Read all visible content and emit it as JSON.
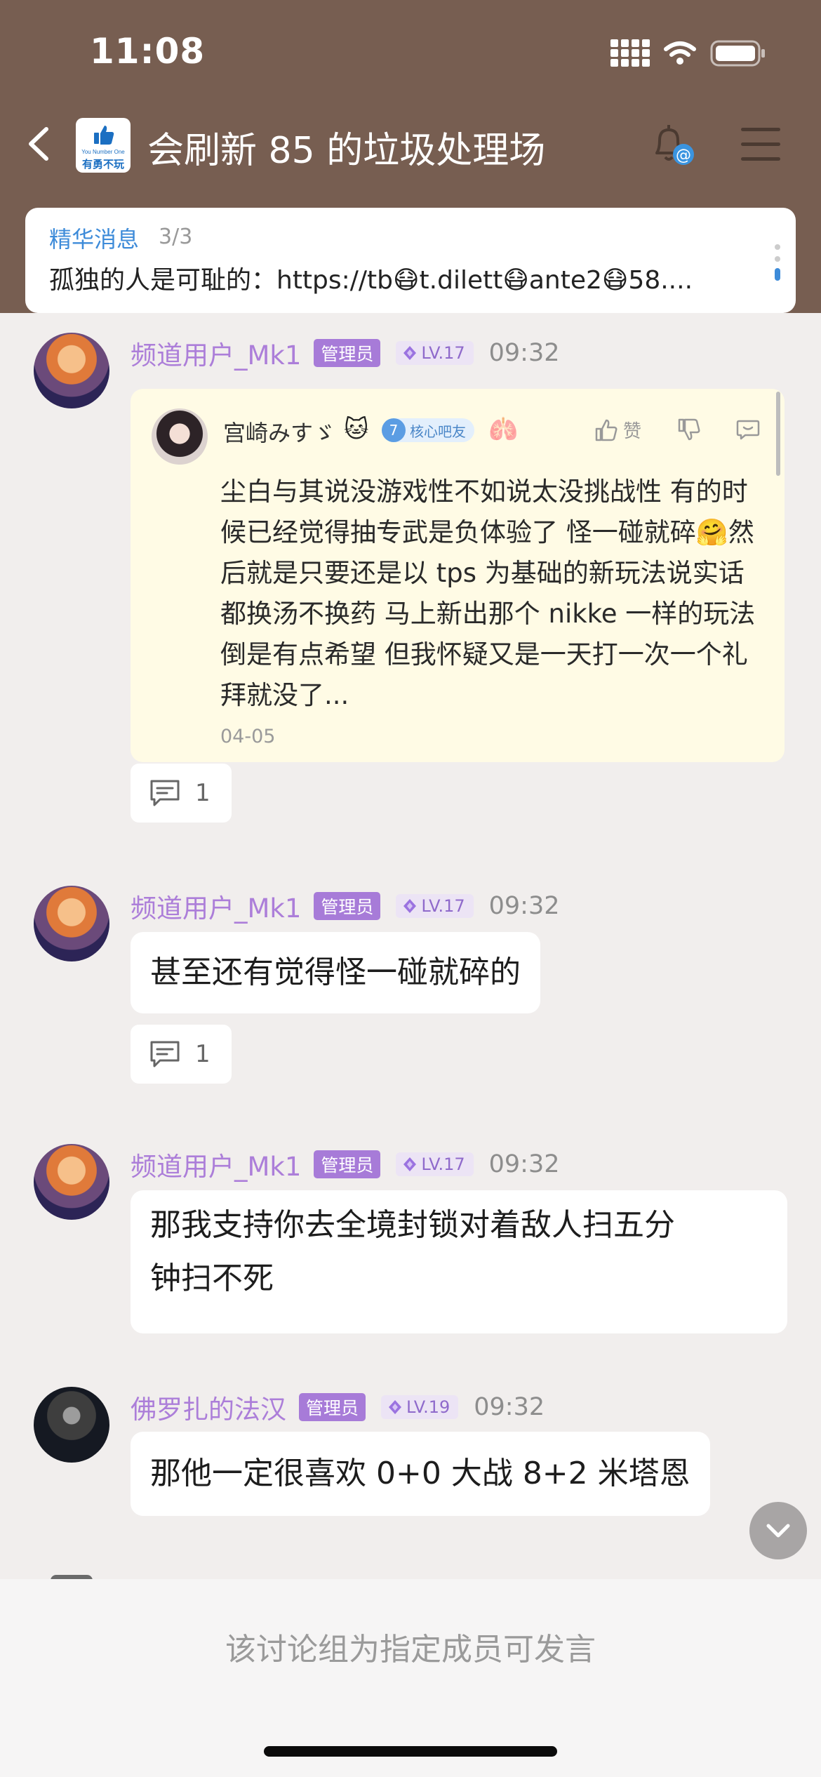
{
  "status_bar": {
    "time": "11:08"
  },
  "nav": {
    "title": "会刷新 85 的垃圾处理场",
    "logo": {
      "text_en": "You Number One",
      "text_cn": "有勇不玩"
    }
  },
  "essence": {
    "label": "精华消息",
    "count": "3/3",
    "text": "孤独的人是可耻的：https://tb😷t.dilett😷ante2😷58...."
  },
  "messages": [
    {
      "user": "频道用户_Mk1",
      "role": "管理员",
      "level": "LV.17",
      "time": "09:32",
      "quote": {
        "user": "宫崎みすゞ",
        "user_emoji": "🐱",
        "badge_num": "7",
        "badge_text": "核心吧友",
        "emoji2": "🫁",
        "like_label": "赞",
        "text": "尘白与其说没游戏性不如说太没挑战性 有的时候已经觉得抽专武是负体验了 怪一碰就碎🤗然后就是只要还是以 tps 为基础的新玩法说实话都换汤不换药 马上新出那个 nikke 一样的玩法倒是有点希望 但我怀疑又是一天打一次一个礼拜就没了...",
        "date": "04-05"
      },
      "replies": "1"
    },
    {
      "user": "频道用户_Mk1",
      "role": "管理员",
      "level": "LV.17",
      "time": "09:32",
      "text": "甚至还有觉得怪一碰就碎的",
      "replies": "1"
    },
    {
      "user": "频道用户_Mk1",
      "role": "管理员",
      "level": "LV.17",
      "time": "09:32",
      "text_line1": "那我支持你去全境封锁对着敌人扫五分",
      "text_line2": "钟扫不死"
    },
    {
      "user": "佛罗扎的法汉",
      "role": "管理员",
      "level": "LV.19",
      "time": "09:32",
      "text": "那他一定很喜欢 0+0 大战 8+2 米塔恩"
    }
  ],
  "bottom": {
    "hint": "该讨论组为指定成员可发言"
  },
  "colors": {
    "header": "#775e51",
    "username": "#ac7ed9",
    "admin_badge": "#a77bd8",
    "essence_label": "#3d8bd9",
    "quote_bg": "#fffbe5",
    "page_bg": "#f1eeed"
  },
  "icons": [
    "back-arrow-icon",
    "thumbs-up-icon",
    "bell-at-icon",
    "menu-icon",
    "level-gem-icon",
    "like-icon",
    "dislike-icon",
    "more-icon",
    "comment-icon",
    "chevron-down-icon"
  ]
}
